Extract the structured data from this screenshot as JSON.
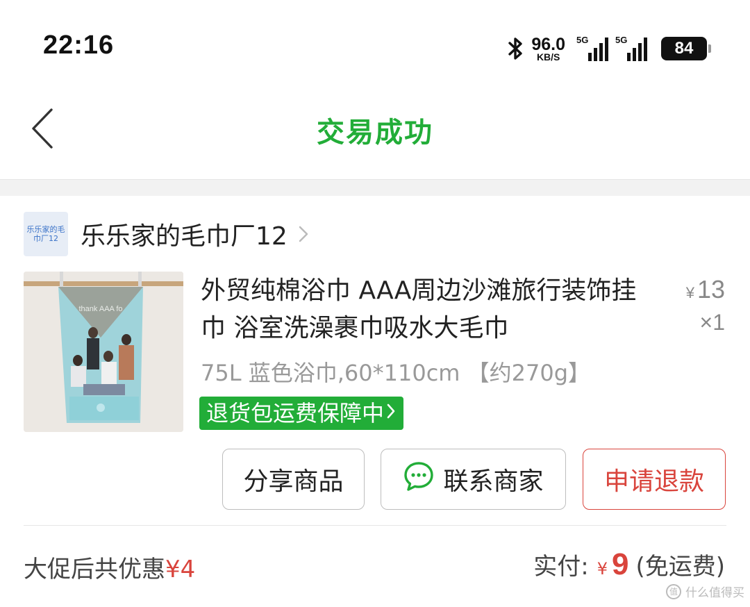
{
  "status_bar": {
    "time": "22:16",
    "net_speed_value": "96.0",
    "net_speed_unit": "KB/S",
    "sim1_label": "5G",
    "sim2_label": "5G",
    "battery": "84"
  },
  "header": {
    "title": "交易成功"
  },
  "shop": {
    "avatar_text": "乐乐家的毛巾厂12",
    "name": "乐乐家的毛巾厂12"
  },
  "product": {
    "title": "外贸纯棉浴巾 AAA周边沙滩旅行装饰挂巾 浴室洗澡裹巾吸水大毛巾",
    "currency": "¥",
    "price": "13",
    "quantity": "×1",
    "spec": "75L 蓝色浴巾,60*110cm 【约270g】",
    "guarantee_tag": "退货包运费保障中",
    "thumbnail_text": "thank AAA fo"
  },
  "actions": {
    "share": "分享商品",
    "contact": "联系商家",
    "refund": "申请退款"
  },
  "summary": {
    "discount_label": "大促后共优惠",
    "discount_amount": "¥4",
    "paid_label": "实付:",
    "currency": "¥",
    "paid_amount": "9",
    "shipping_note": "(免运费)"
  },
  "watermark": {
    "text": "什么值得买"
  },
  "colors": {
    "accent_green": "#22ad38",
    "refund_red": "#d9443c"
  }
}
